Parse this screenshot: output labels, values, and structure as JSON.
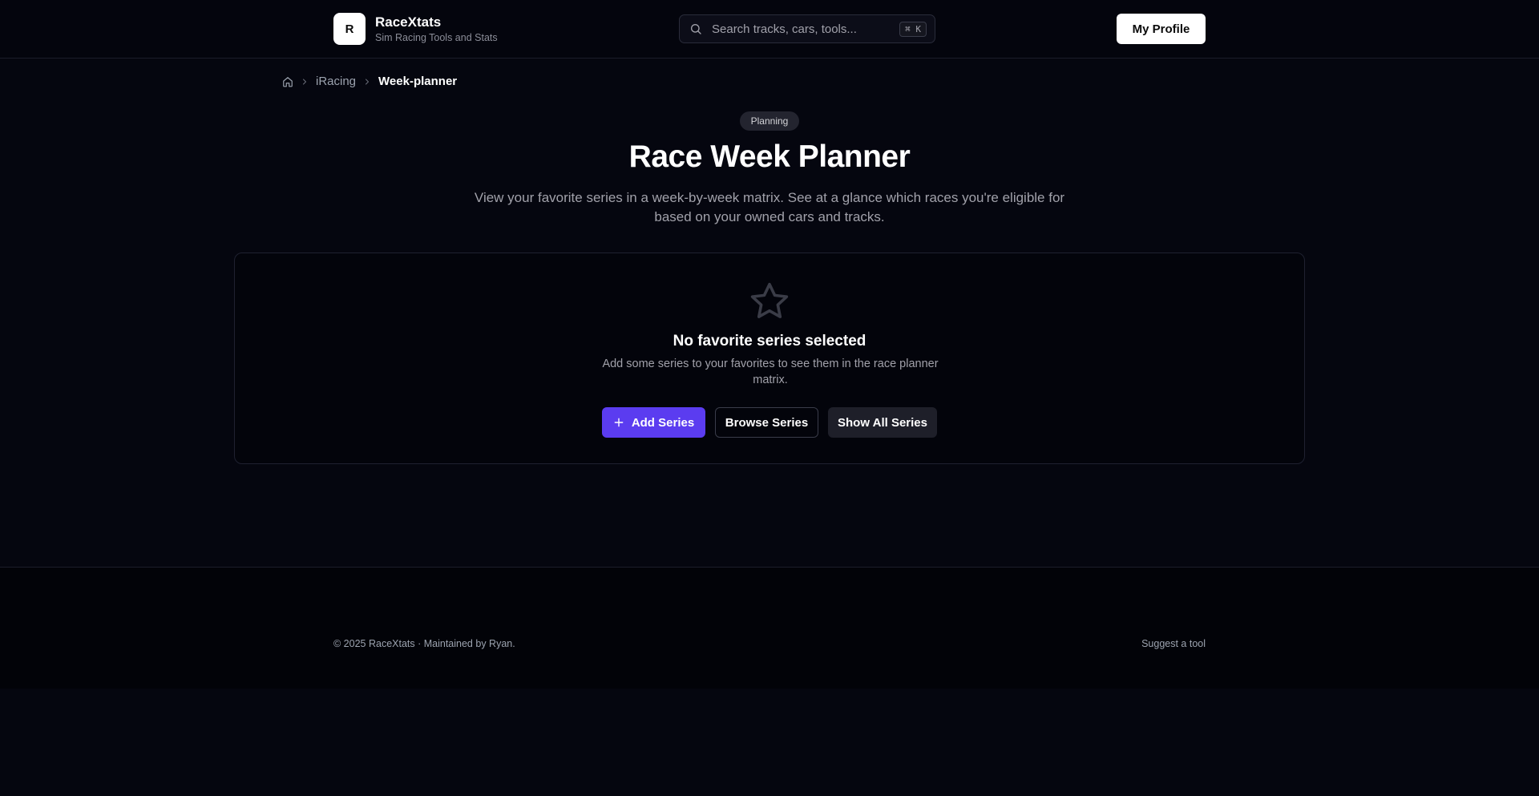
{
  "header": {
    "logo_letter": "R",
    "brand_name": "RaceXtats",
    "brand_tagline": "Sim Racing Tools and Stats",
    "search_placeholder": "Search tracks, cars, tools...",
    "search_shortcut": "⌘ K",
    "profile_button": "My Profile"
  },
  "breadcrumb": {
    "items": [
      "iRacing"
    ],
    "current": "Week-planner"
  },
  "hero": {
    "badge": "Planning",
    "title": "Race Week Planner",
    "description": "View your favorite series in a week-by-week matrix. See at a glance which races you're eligible for based on your owned cars and tracks."
  },
  "empty_state": {
    "icon": "star-icon",
    "title": "No favorite series selected",
    "description": "Add some series to your favorites to see them in the race planner matrix.",
    "buttons": {
      "add": "Add Series",
      "browse": "Browse Series",
      "show_all": "Show All Series"
    }
  },
  "footer": {
    "copyright": "© 2025 RaceXtats · Maintained by Ryan.",
    "suggest_link": "Suggest a tool"
  },
  "colors": {
    "background": "#05060f",
    "accent": "#5b3cf0",
    "muted_text": "#a1a1aa"
  }
}
